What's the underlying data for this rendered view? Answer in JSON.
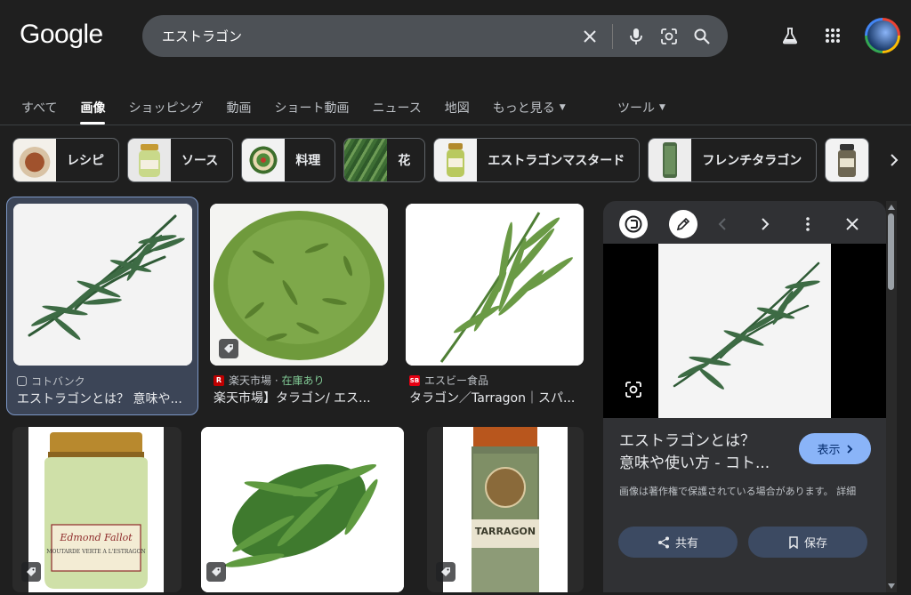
{
  "logo": "Google",
  "search": {
    "query": "エストラゴン"
  },
  "tabs": [
    {
      "label": "すべて"
    },
    {
      "label": "画像"
    },
    {
      "label": "ショッピング"
    },
    {
      "label": "動画"
    },
    {
      "label": "ショート動画"
    },
    {
      "label": "ニュース"
    },
    {
      "label": "地図"
    },
    {
      "label": "もっと見る"
    }
  ],
  "tools_label": "ツール",
  "chips": [
    {
      "label": "レシピ"
    },
    {
      "label": "ソース"
    },
    {
      "label": "料理"
    },
    {
      "label": "花"
    },
    {
      "label": "エストラゴンマスタード"
    },
    {
      "label": "フレンチタラゴン"
    }
  ],
  "results": [
    {
      "source": "コトバンク",
      "title": "エストラゴンとは？ 意味や..."
    },
    {
      "source": "楽天市場",
      "stock": "在庫あり",
      "title": "楽天市場】タラゴン/ エス..."
    },
    {
      "source": "エスビー食品",
      "title": "タラゴン／Tarragon｜スパ..."
    }
  ],
  "preview": {
    "title_line1": "エストラゴンとは？",
    "title_line2": "意味や使い方 - コト...",
    "visit_label": "表示",
    "copyright_note": "画像は著作権で保護されている場合があります。 詳細",
    "share_label": "共有",
    "save_label": "保存"
  },
  "colors": {
    "background": "#1f1f1f",
    "search_box": "#4d5156",
    "accent": "#8ab4f8",
    "selected_card": "#3c4557"
  }
}
